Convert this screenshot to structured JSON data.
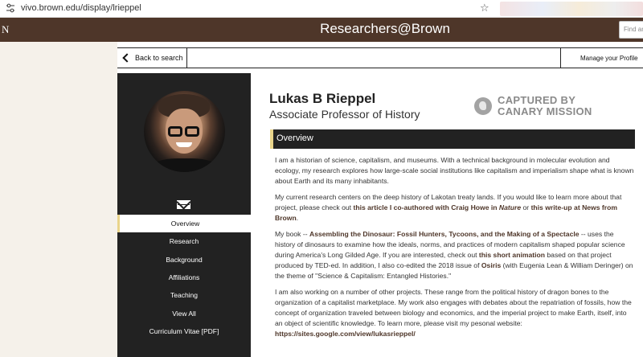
{
  "browser": {
    "url": "vivo.brown.edu/display/lrieppel"
  },
  "banner": {
    "edge_letter": "N",
    "brand": "Researchers@Brown",
    "search_placeholder": "Find an"
  },
  "backbar": {
    "back_label": "Back to search",
    "manage_label": "Manage your Profile"
  },
  "profile": {
    "name": "Lukas B Rieppel",
    "position": "Associate Professor of History"
  },
  "stamp": {
    "line1": "CAPTURED BY",
    "line2": "CANARY MISSION"
  },
  "nav": [
    "Overview",
    "Research",
    "Background",
    "Affiliations",
    "Teaching",
    "View All",
    "Curriculum Vitae [PDF]"
  ],
  "overview": {
    "heading": "Overview",
    "p1": "I am a historian of science, capitalism, and museums. With a technical background in molecular evolution and ecology, my research explores how large-scale social institutions like capitalism and imperialism shape what is known about Earth and its many inhabitants.",
    "p2_a": "My current research centers on the deep history of Lakotan treaty lands. If you would like to learn more about that project,  please check out ",
    "p2_link1": "this article I co-authored with Craig Howe in ",
    "p2_link1_i": "Nature",
    "p2_b": " or ",
    "p2_link2": "this write-up at News from Brown",
    "p2_c": ".",
    "p3_a": "My book -- ",
    "p3_link1": "Assembling the Dinosaur: Fossil Hunters, Tycoons, and the Making of a Spectacle",
    "p3_b": " -- uses the history of dinosaurs to examine how the ideals, norms, and practices of modern capitalism shaped popular science during America's Long Gilded Age. If you are interested, check out ",
    "p3_link2": "this short animation",
    "p3_c": " based on that project produced by TED-ed. In addition, I also co-edited the 2018  issue of ",
    "p3_link3": "Osiris",
    "p3_d": " (with Eugenia Lean & William Deringer) on the theme of \"Science & Capitalism: Entangled Histories.\"",
    "p4_a": "I am also working on a number of other projects. These range from the political history of dragon bones to the organization of a capitalist marketplace. My work also engages with debates about the repatriation of fossils, how the concept of organization traveled between biology and economics, and the imperial project to make Earth, itself, into an object of scientific knowledge. To learn more, please visit my pesonal website: ",
    "p4_link": "https://sites.google.com/view/lukasrieppel/"
  },
  "colors": {
    "brown": "#4e3629",
    "dark": "#222222",
    "gold": "#e9d48a",
    "gutter": "#f5f1ea"
  }
}
